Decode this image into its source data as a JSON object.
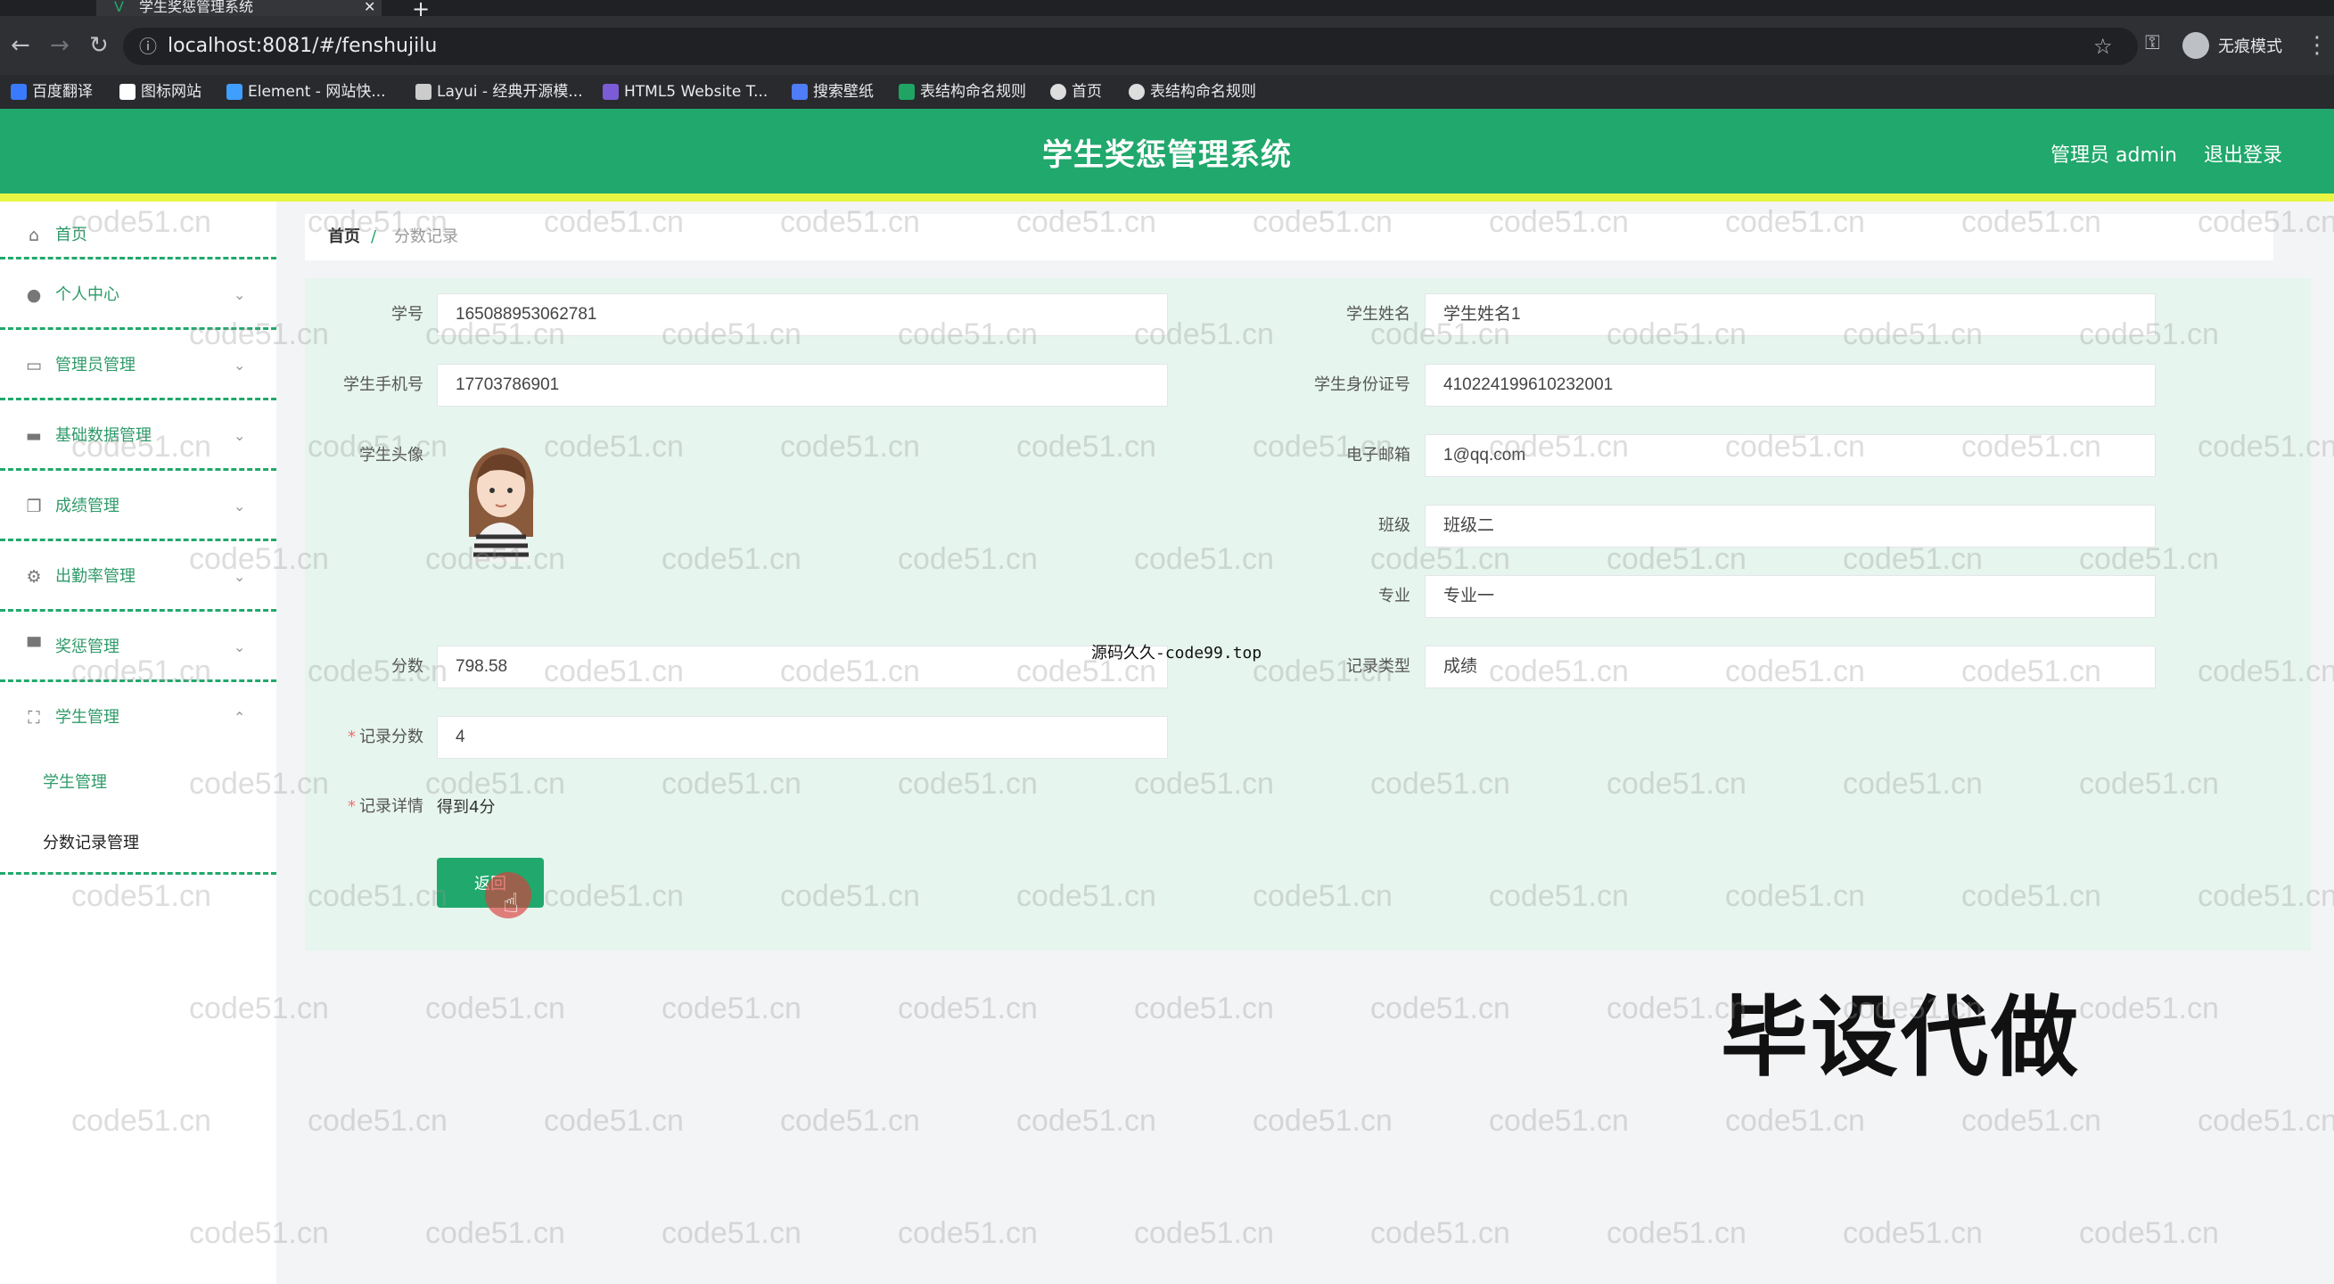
{
  "browser": {
    "tab_title": "学生奖惩管理系统",
    "url": "localhost:8081/#/fenshujilu",
    "incognito_label": "无痕模式",
    "bookmarks": [
      {
        "label": "百度翻译",
        "color": "#3a7afe"
      },
      {
        "label": "图标网站",
        "color": "#ffffff"
      },
      {
        "label": "Element - 网站快...",
        "color": "#409eff"
      },
      {
        "label": "Layui - 经典开源模...",
        "color": "#cccccc"
      },
      {
        "label": "HTML5 Website T...",
        "color": "#7b5cd6"
      },
      {
        "label": "搜索壁纸",
        "color": "#4f7cf7"
      },
      {
        "label": "表结构命名规则",
        "color": "#1fa463"
      },
      {
        "label": "首页",
        "color": "#dddddd"
      },
      {
        "label": "表结构命名规则",
        "color": "#dddddd"
      }
    ]
  },
  "header": {
    "title": "学生奖惩管理系统",
    "admin_label": "管理员 admin",
    "logout_label": "退出登录",
    "colors": {
      "bar": "#21a86c",
      "stripe": "#e8f542"
    }
  },
  "sidebar": {
    "items": [
      {
        "label": "首页",
        "icon": "home-icon"
      },
      {
        "label": "个人中心",
        "icon": "user-icon"
      },
      {
        "label": "管理员管理",
        "icon": "message-icon"
      },
      {
        "label": "基础数据管理",
        "icon": "chat-icon"
      },
      {
        "label": "成绩管理",
        "icon": "copy-icon"
      },
      {
        "label": "出勤率管理",
        "icon": "gear-icon"
      },
      {
        "label": "奖惩管理",
        "icon": "folder-icon"
      },
      {
        "label": "学生管理",
        "icon": "expand-icon"
      }
    ],
    "sub_items": [
      {
        "label": "学生管理"
      },
      {
        "label": "分数记录管理"
      }
    ]
  },
  "breadcrumb": {
    "home": "首页",
    "separator": "/",
    "current": "分数记录"
  },
  "form": {
    "student_no": {
      "label": "学号",
      "value": "165088953062781"
    },
    "student_name": {
      "label": "学生姓名",
      "value": "学生姓名1"
    },
    "phone": {
      "label": "学生手机号",
      "value": "17703786901"
    },
    "id_card": {
      "label": "学生身份证号",
      "value": "410224199610232001"
    },
    "avatar": {
      "label": "学生头像"
    },
    "email": {
      "label": "电子邮箱",
      "value": "1@qq.com"
    },
    "class": {
      "label": "班级",
      "value": "班级二"
    },
    "major": {
      "label": "专业",
      "value": "专业一"
    },
    "score": {
      "label": "分数",
      "value": "798.58"
    },
    "record_type": {
      "label": "记录类型",
      "value": "成绩"
    },
    "record_score": {
      "label": "记录分数",
      "value": "4",
      "required_mark": "*"
    },
    "record_detail": {
      "label": "记录详情",
      "value": "得到4分",
      "required_mark": "*"
    },
    "back_button": "返回"
  },
  "overlays": {
    "code99": "源码久久-code99.top",
    "promo": "毕设代做",
    "watermark": "code51.cn"
  }
}
